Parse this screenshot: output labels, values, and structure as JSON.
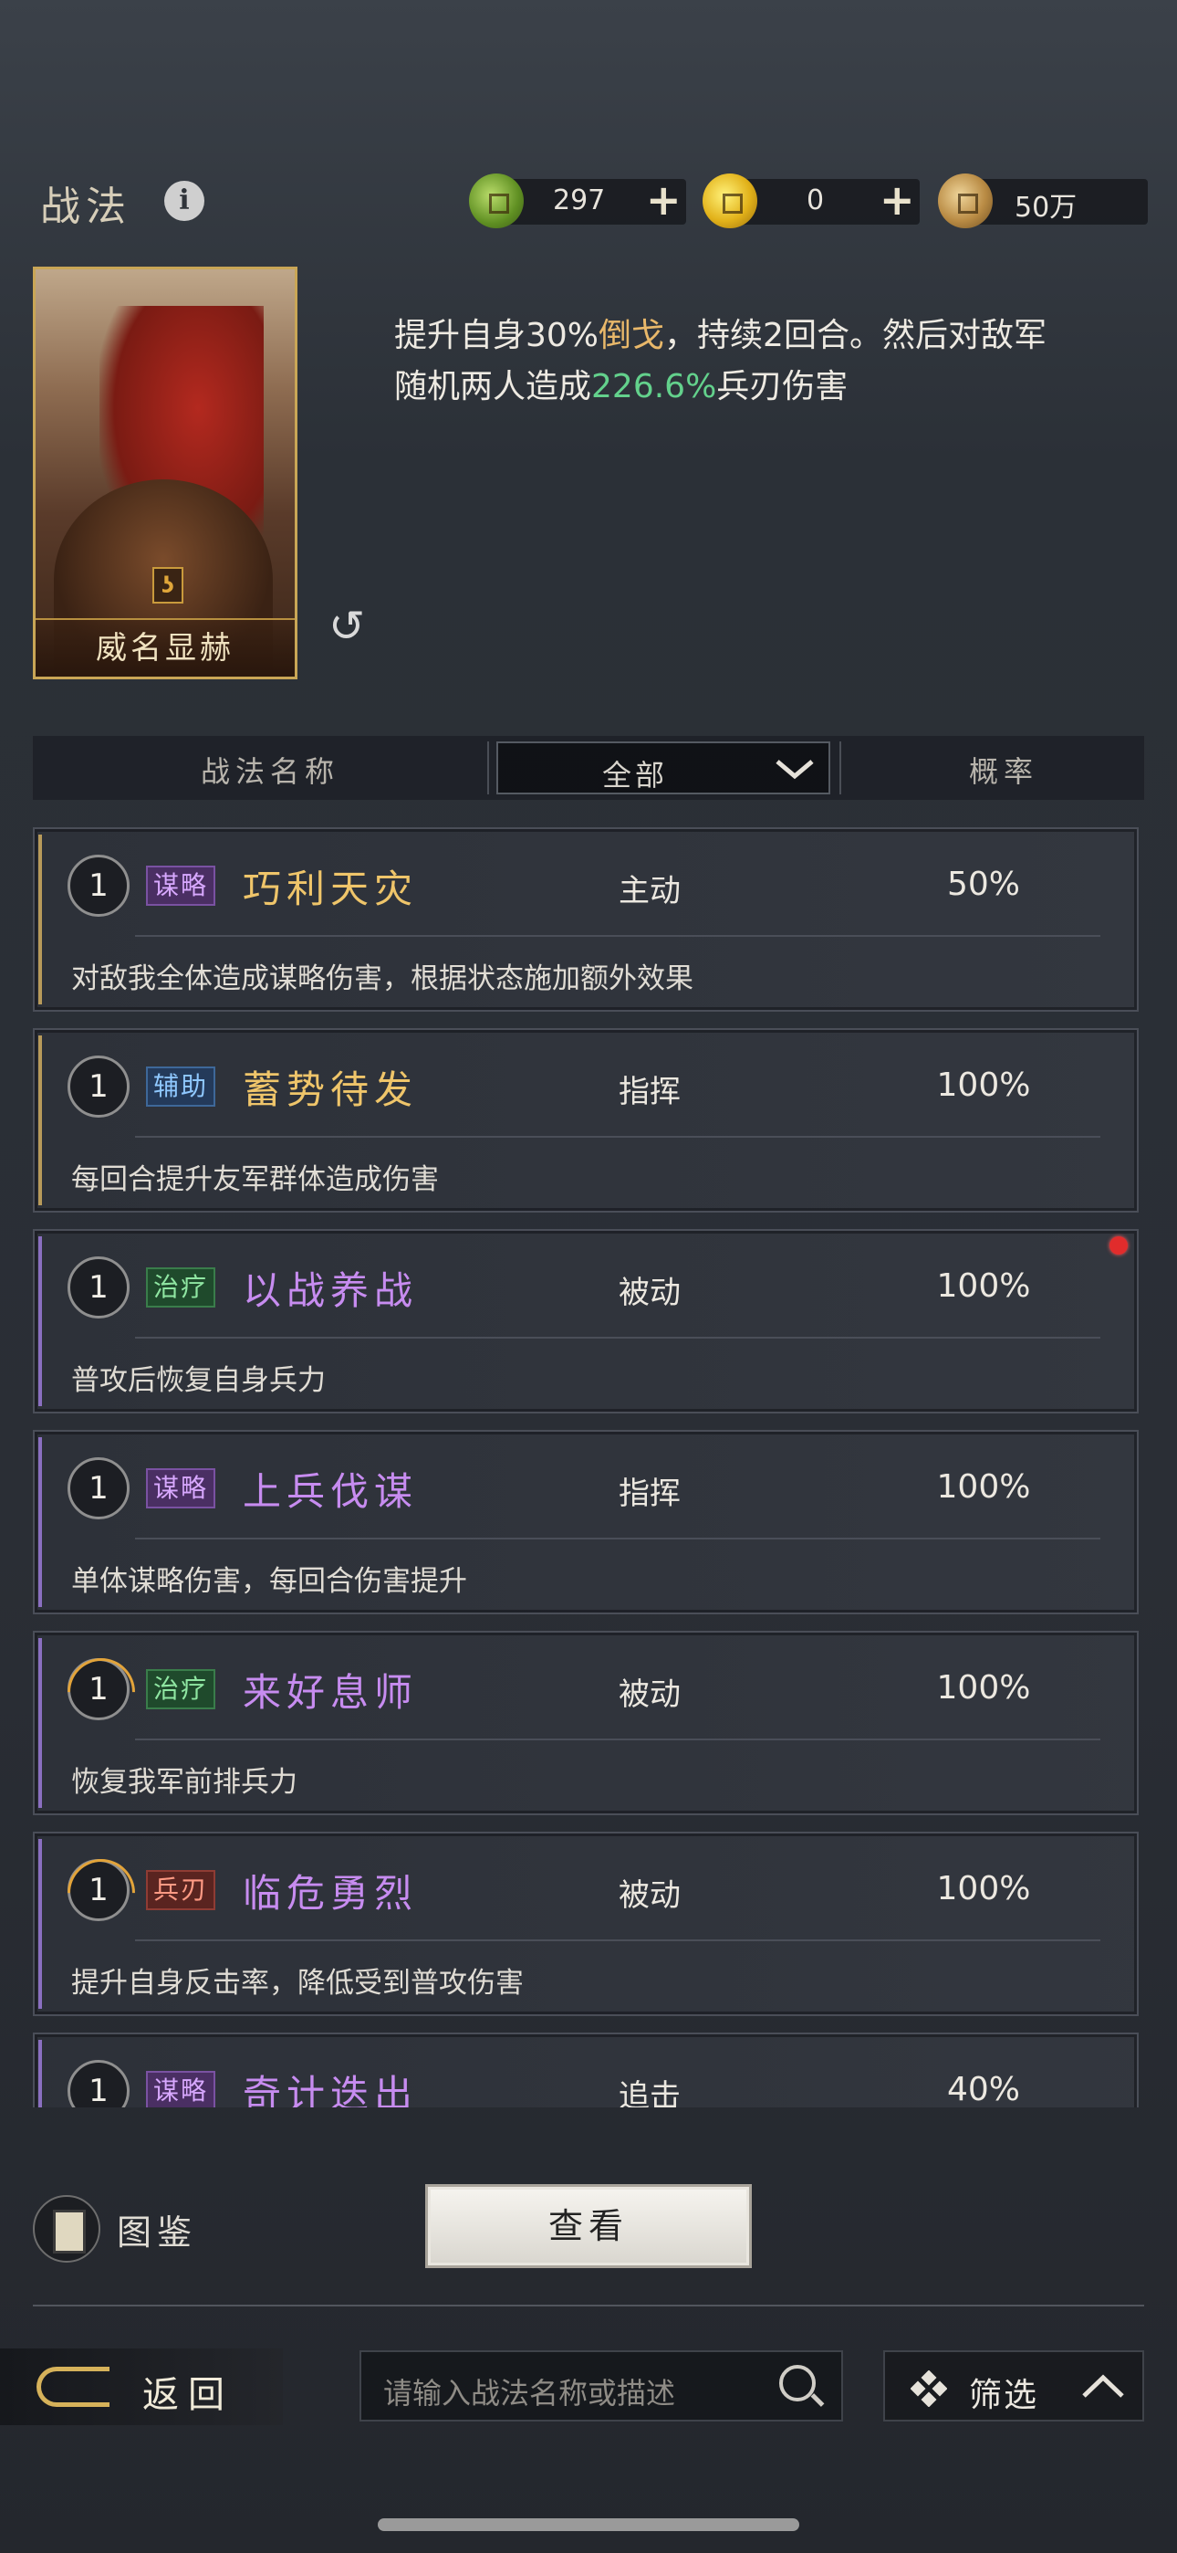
{
  "header": {
    "title": "战法",
    "resources": [
      {
        "name": "jade-coin",
        "value": "297",
        "has_plus": true
      },
      {
        "name": "gold-coin",
        "value": "0",
        "has_plus": true
      },
      {
        "name": "copper-coin",
        "value": "50万",
        "has_plus": false
      }
    ]
  },
  "selected": {
    "card_name": "威名显赫",
    "desc_parts": [
      "提升自身30%",
      "倒戈",
      "，持续2回合。然后对敌军随机两人造成",
      "226.6%",
      "兵刃伤害"
    ]
  },
  "columns": {
    "name": "战法名称",
    "filter_value": "全部",
    "rate": "概率"
  },
  "items": [
    {
      "level": "1",
      "tag": "谋略",
      "name": "巧利天灾",
      "type": "主动",
      "rate": "50%",
      "desc": "对敌我全体造成谋略伤害，根据状态施加额外效果"
    },
    {
      "level": "1",
      "tag": "辅助",
      "name": "蓄势待发",
      "type": "指挥",
      "rate": "100%",
      "desc": "每回合提升友军群体造成伤害"
    },
    {
      "level": "1",
      "tag": "治疗",
      "name": "以战养战",
      "type": "被动",
      "rate": "100%",
      "desc": "普攻后恢复自身兵力"
    },
    {
      "level": "1",
      "tag": "谋略",
      "name": "上兵伐谋",
      "type": "指挥",
      "rate": "100%",
      "desc": "单体谋略伤害，每回合伤害提升"
    },
    {
      "level": "1",
      "tag": "治疗",
      "name": "来好息师",
      "type": "被动",
      "rate": "100%",
      "desc": "恢复我军前排兵力"
    },
    {
      "level": "1",
      "tag": "兵刃",
      "name": "临危勇烈",
      "type": "被动",
      "rate": "100%",
      "desc": "提升自身反击率，降低受到普攻伤害"
    },
    {
      "level": "1",
      "tag": "谋略",
      "name": "奇计迭出",
      "type": "追击",
      "rate": "40%",
      "desc": ""
    }
  ],
  "bottom": {
    "tujian_label": "图鉴",
    "tujian_icon_char": "鉴",
    "view_label": "查看",
    "back_label": "返回",
    "search_placeholder": "请输入战法名称或描述",
    "filter_label": "筛选"
  },
  "colors": {
    "gold_accent": "#c9a656",
    "highlight_gold": "#e9b86a",
    "highlight_green": "#63d18c",
    "name_purple": "#c78cf0",
    "name_gold": "#efc56a"
  }
}
